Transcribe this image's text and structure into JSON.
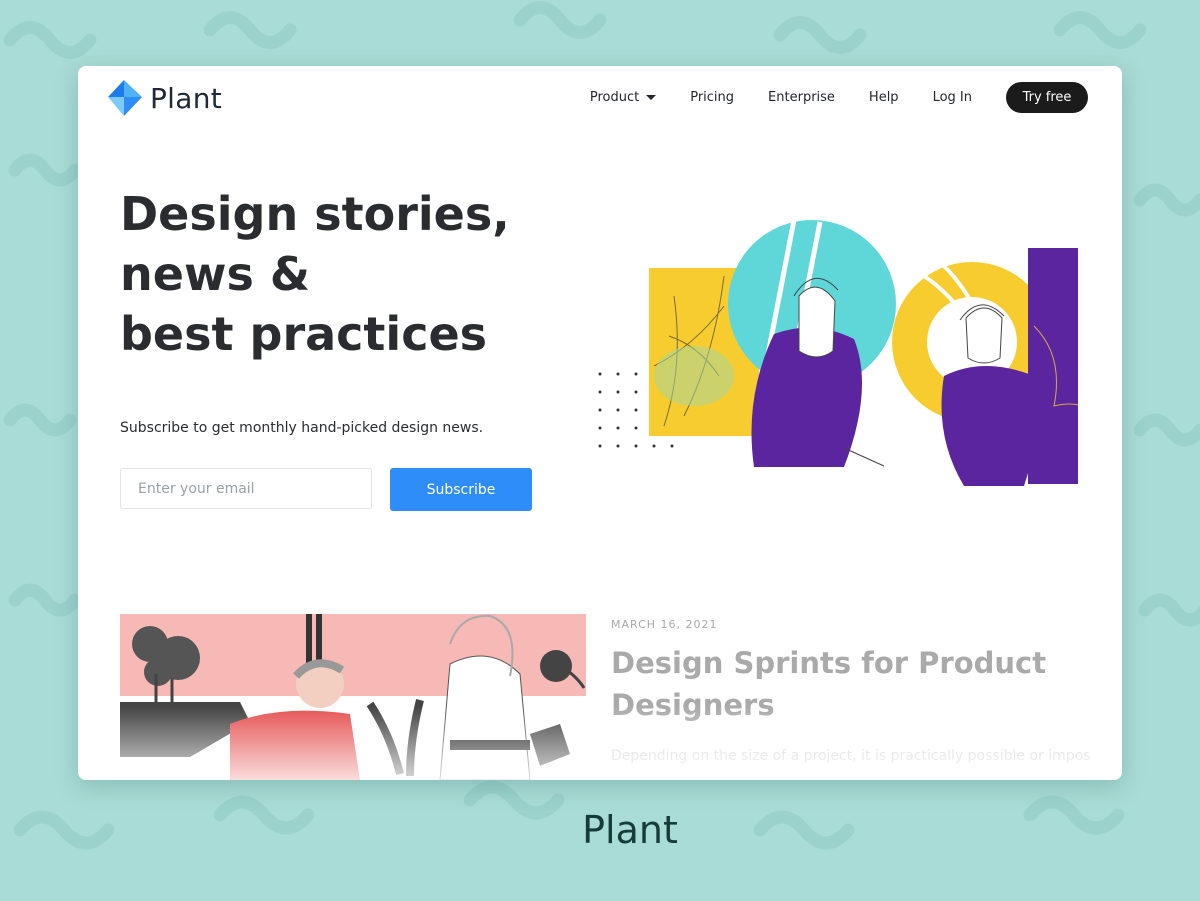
{
  "brand": {
    "name": "Plant"
  },
  "nav": {
    "items": [
      {
        "label": "Product",
        "has_dropdown": true
      },
      {
        "label": "Pricing"
      },
      {
        "label": "Enterprise"
      },
      {
        "label": "Help"
      },
      {
        "label": "Log In"
      }
    ],
    "cta_label": "Try free"
  },
  "hero": {
    "title_lines": [
      "Design stories,",
      "news &",
      "best practices"
    ],
    "subtitle": "Subscribe to get monthly hand-picked design news.",
    "email_placeholder": "Enter your email",
    "subscribe_label": "Subscribe"
  },
  "post": {
    "date": "MARCH 16, 2021",
    "title": "Design Sprints for Product Designers",
    "excerpt": "Depending on the size of a project, it is practically possible or impossible"
  },
  "footer": {
    "brand": "Plant"
  },
  "colors": {
    "background": "#a9dcd6",
    "accent_blue": "#2f8dfa",
    "cta_dark": "#1b1b1b",
    "illus_teal": "#5fd6d8",
    "illus_yellow": "#f7cc2e",
    "illus_purple": "#5a259e"
  }
}
